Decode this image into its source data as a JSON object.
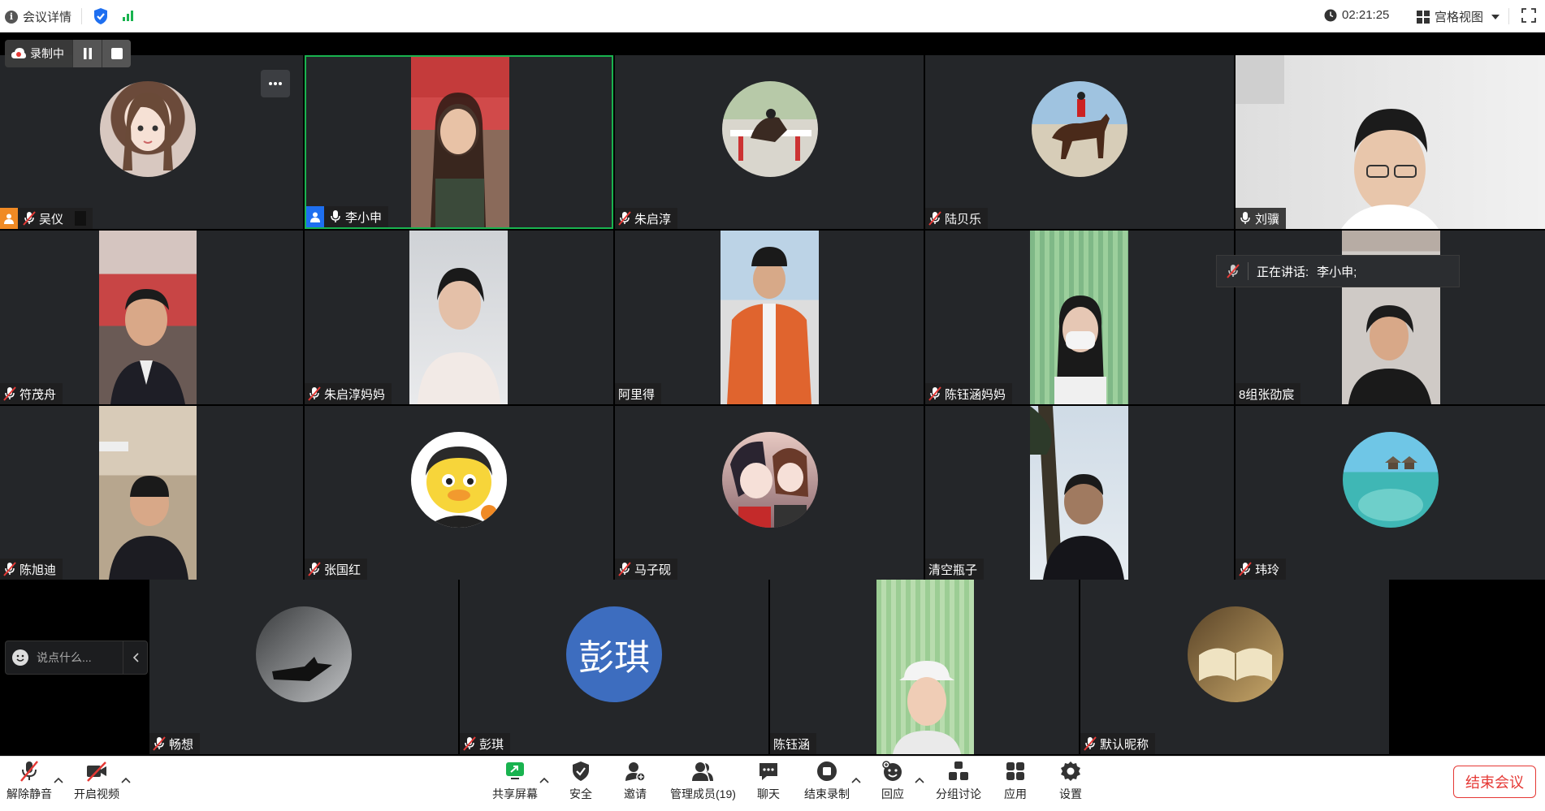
{
  "topbar": {
    "details_label": "会议详情",
    "timer": "02:21:25",
    "view_label": "宫格视图"
  },
  "recording": {
    "label": "录制中"
  },
  "speaking": {
    "label": "正在讲话:",
    "name": "李小申;"
  },
  "chat": {
    "placeholder": "说点什么..."
  },
  "participants": [
    {
      "name": "吴仪",
      "muted": true
    },
    {
      "name": "李小申",
      "muted": false
    },
    {
      "name": "朱启淳",
      "muted": true
    },
    {
      "name": "陆贝乐",
      "muted": true
    },
    {
      "name": "刘骥",
      "muted": false
    },
    {
      "name": "符茂舟",
      "muted": true
    },
    {
      "name": "朱启淳妈妈",
      "muted": true
    },
    {
      "name": "阿里得",
      "muted": false
    },
    {
      "name": "陈钰涵妈妈",
      "muted": true
    },
    {
      "name": "8组张劭宸",
      "muted": false
    },
    {
      "name": "陈旭迪",
      "muted": true
    },
    {
      "name": "张国红",
      "muted": true
    },
    {
      "name": "马子砚",
      "muted": true
    },
    {
      "name": "清空瓶子",
      "muted": false
    },
    {
      "name": "玮玲",
      "muted": true
    },
    {
      "name": "畅想",
      "muted": true
    },
    {
      "name": "彭琪",
      "muted": true
    },
    {
      "name": "陈钰涵",
      "muted": false
    },
    {
      "name": "默认昵称",
      "muted": true
    }
  ],
  "avatar_text": {
    "pengqi": "彭琪"
  },
  "toolbar": {
    "unmute": "解除静音",
    "start_video": "开启视频",
    "share_screen": "共享屏幕",
    "security": "安全",
    "invite": "邀请",
    "manage_members": "管理成员(19)",
    "chat": "聊天",
    "end_recording": "结束录制",
    "reactions": "回应",
    "breakout": "分组讨论",
    "apps": "应用",
    "settings": "设置",
    "end_meeting": "结束会议"
  },
  "colors": {
    "active_border": "#19b34f",
    "tile_bg": "#242629",
    "end_meeting": "#e53935",
    "muted_icon": "#e53935",
    "share_green": "#19b34f"
  }
}
